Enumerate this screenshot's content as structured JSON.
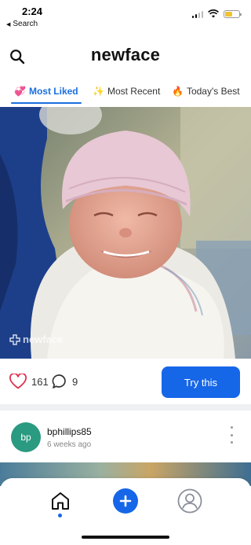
{
  "status_bar": {
    "time": "2:24",
    "back_label": "Search",
    "back_icon": "back-triangle-icon",
    "battery_color": "#f2c230"
  },
  "header": {
    "title": "newface",
    "search_icon": "search-icon"
  },
  "tabs": [
    {
      "icon": "💞",
      "icon_name": "hearts-icon",
      "label": "Most Liked",
      "active": true
    },
    {
      "icon": "✨",
      "icon_name": "sparkles-icon",
      "label": "Most Recent",
      "active": false
    },
    {
      "icon": "🔥",
      "icon_name": "fire-icon",
      "label": "Today's Best",
      "active": false
    }
  ],
  "post": {
    "watermark": "newface",
    "likes": "161",
    "comments": "9",
    "try_label": "Try this"
  },
  "next_post": {
    "avatar_initials": "bp",
    "avatar_color": "#2a9a80",
    "username": "bphillips85",
    "timestamp": "6 weeks ago"
  },
  "bottom_nav": {
    "items": [
      "home-icon",
      "add-icon",
      "profile-icon"
    ],
    "accent": "#1666e8"
  },
  "colors": {
    "accent": "#1a6fe0",
    "button": "#1666e8"
  }
}
